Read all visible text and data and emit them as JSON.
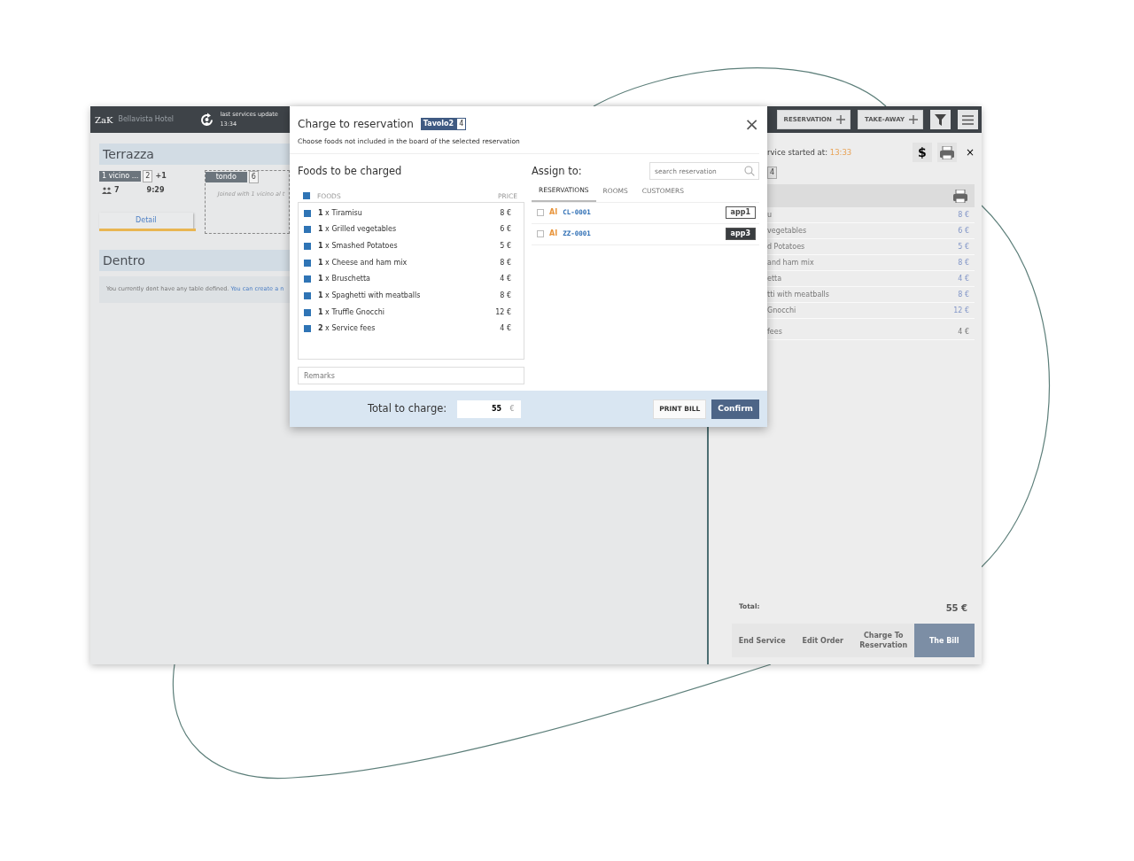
{
  "header": {
    "logo": "ZaK",
    "hotel": "Bellavista Hotel",
    "update_label": "last services update",
    "update_time": "13:34",
    "actions": [
      {
        "label": "RESERVATION",
        "kind": "add"
      },
      {
        "label": "TAKE-AWAY",
        "kind": "add"
      },
      {
        "kind": "filter"
      },
      {
        "kind": "menu"
      }
    ]
  },
  "rooms": [
    {
      "name": "Terrazza",
      "tables": [
        {
          "kind": "occupied",
          "name": "1 vicino ...",
          "seats": "2",
          "extra": "+1",
          "guests": "7",
          "time": "9:29",
          "link": "Detail"
        },
        {
          "kind": "joined",
          "name": "tondo",
          "seats": "6",
          "note": "Joined with 1 vicino al t"
        }
      ]
    },
    {
      "name": "Dentro",
      "message": "You currently dont have any table defined.",
      "link": "You can create a n"
    }
  ],
  "service_panel": {
    "started_label": "rvice started at:",
    "started_time": "13:33",
    "pay_button": "$",
    "close": "×",
    "table_seats": "4",
    "items": [
      {
        "kind": "food",
        "name": "u",
        "price": "8 €"
      },
      {
        "kind": "food",
        "name": "vegetables",
        "price": "6 €"
      },
      {
        "kind": "food",
        "name": "d Potatoes",
        "price": "5 €"
      },
      {
        "kind": "food",
        "name": "and ham mix",
        "price": "8 €"
      },
      {
        "kind": "food",
        "name": "etta",
        "price": "4 €"
      },
      {
        "kind": "food",
        "name": "tti with meatballs",
        "price": "8 €"
      },
      {
        "kind": "food",
        "name": "Gnocchi",
        "price": "12 €"
      },
      {
        "kind": "fee",
        "name": "fees",
        "price": "4 €"
      }
    ],
    "total_label": "Total:",
    "total": "55 €",
    "actions": [
      {
        "label": "End Service",
        "selected": false
      },
      {
        "label": "Edit Order",
        "selected": false
      },
      {
        "label": "Charge To Reservation",
        "selected": false
      },
      {
        "label": "The Bill",
        "selected": true
      }
    ]
  },
  "modal": {
    "title": "Charge to reservation",
    "table_badge": "Tavolo2",
    "table_seats": "4",
    "close": "×",
    "subtitle": "Choose foods not included in the board of the selected reservation",
    "foods": {
      "heading": "Foods to be charged",
      "select_all": true,
      "columns": [
        "FOODS",
        "PRICE"
      ],
      "items": [
        {
          "label": "**1** x Tiramisu",
          "price": "8 €",
          "checked": true
        },
        {
          "label": "**1** x Grilled vegetables",
          "price": "6 €",
          "checked": true
        },
        {
          "label": "**1** x Smashed Potatoes",
          "price": "5 €",
          "checked": true
        },
        {
          "label": "**1** x Cheese and ham mix",
          "price": "8 €",
          "checked": true
        },
        {
          "label": "**1** x Bruschetta",
          "price": "4 €",
          "checked": true
        },
        {
          "label": "**1** x Spaghetti with meatballs",
          "price": "8 €",
          "checked": true
        },
        {
          "label": "**1** x Truffle Gnocchi",
          "price": "12 €",
          "checked": true
        },
        {
          "label": "**2** x Service fees",
          "price": "4 €",
          "checked": true
        }
      ],
      "remarks_placeholder": "Remarks"
    },
    "assign": {
      "heading": "Assign to:",
      "search_placeholder": "search reservation",
      "tabs": [
        {
          "label": "RESERVATIONS",
          "selected": true
        },
        {
          "label": "ROOMS",
          "selected": false
        },
        {
          "label": "CUSTOMERS",
          "selected": false
        }
      ],
      "reservations": [
        {
          "prefix": "AI",
          "code": "CL-0001",
          "tag": "app1",
          "kind": "outline",
          "checked": false
        },
        {
          "prefix": "AI",
          "code": "ZZ-0001",
          "tag": "app3",
          "kind": "filled",
          "checked": false
        }
      ]
    },
    "footer": {
      "total_label": "Total to charge:",
      "total": "55",
      "currency": "€",
      "print": "PRINT BILL",
      "confirm": "Confirm"
    }
  }
}
